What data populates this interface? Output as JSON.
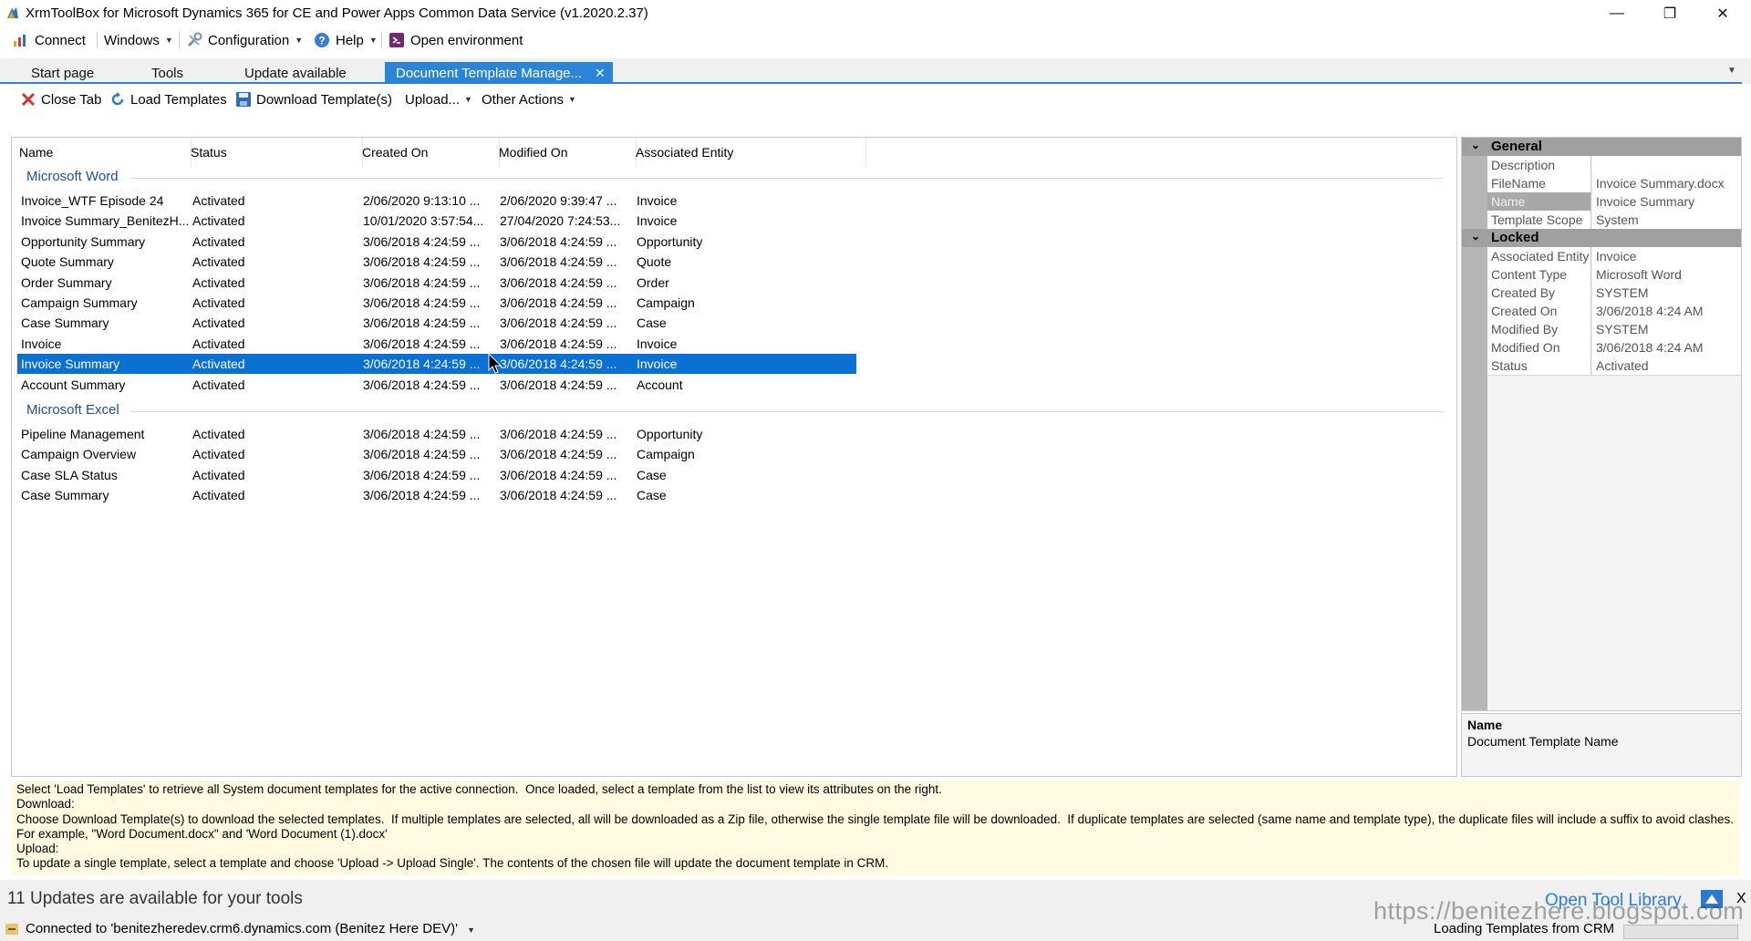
{
  "window": {
    "title": "XrmToolBox for Microsoft Dynamics 365 for CE and Power Apps Common Data Service (v1.2020.2.37)",
    "minimize": "—",
    "maximize": "❐",
    "close": "✕"
  },
  "menu": {
    "connect": "Connect",
    "windows": "Windows",
    "configuration": "Configuration",
    "help": "Help",
    "open_env": "Open environment"
  },
  "tabs": [
    "Start page",
    "Tools",
    "Update available",
    "Document Template Manage..."
  ],
  "toolbar": {
    "close_tab": "Close Tab",
    "load_templates": "Load Templates",
    "download": "Download Template(s)",
    "upload": "Upload...",
    "other": "Other Actions"
  },
  "list": {
    "columns": [
      "Name",
      "Status",
      "Created On",
      "Modified On",
      "Associated Entity"
    ],
    "groups": [
      {
        "label": "Microsoft Word",
        "rows": [
          [
            "Invoice_WTF Episode 24",
            "Activated",
            "2/06/2020 9:13:10 ...",
            "2/06/2020 9:39:47 ...",
            "Invoice"
          ],
          [
            "Invoice Summary_BenitezH...",
            "Activated",
            "10/01/2020 3:57:54...",
            "27/04/2020 7:24:53...",
            "Invoice"
          ],
          [
            "Opportunity Summary",
            "Activated",
            "3/06/2018 4:24:59 ...",
            "3/06/2018 4:24:59 ...",
            "Opportunity"
          ],
          [
            "Quote Summary",
            "Activated",
            "3/06/2018 4:24:59 ...",
            "3/06/2018 4:24:59 ...",
            "Quote"
          ],
          [
            "Order Summary",
            "Activated",
            "3/06/2018 4:24:59 ...",
            "3/06/2018 4:24:59 ...",
            "Order"
          ],
          [
            "Campaign Summary",
            "Activated",
            "3/06/2018 4:24:59 ...",
            "3/06/2018 4:24:59 ...",
            "Campaign"
          ],
          [
            "Case Summary",
            "Activated",
            "3/06/2018 4:24:59 ...",
            "3/06/2018 4:24:59 ...",
            "Case"
          ],
          [
            "Invoice",
            "Activated",
            "3/06/2018 4:24:59 ...",
            "3/06/2018 4:24:59 ...",
            "Invoice"
          ],
          [
            "Invoice Summary",
            "Activated",
            "3/06/2018 4:24:59 ...",
            "3/06/2018 4:24:59 ...",
            "Invoice"
          ],
          [
            "Account Summary",
            "Activated",
            "3/06/2018 4:24:59 ...",
            "3/06/2018 4:24:59 ...",
            "Account"
          ]
        ]
      },
      {
        "label": "Microsoft Excel",
        "rows": [
          [
            "Pipeline Management",
            "Activated",
            "3/06/2018 4:24:59 ...",
            "3/06/2018 4:24:59 ...",
            "Opportunity"
          ],
          [
            "Campaign Overview",
            "Activated",
            "3/06/2018 4:24:59 ...",
            "3/06/2018 4:24:59 ...",
            "Campaign"
          ],
          [
            "Case SLA Status",
            "Activated",
            "3/06/2018 4:24:59 ...",
            "3/06/2018 4:24:59 ...",
            "Case"
          ],
          [
            "Case Summary",
            "Activated",
            "3/06/2018 4:24:59 ...",
            "3/06/2018 4:24:59 ...",
            "Case"
          ]
        ]
      }
    ],
    "selected_group": 0,
    "selected_row": 8
  },
  "properties": {
    "categories": [
      {
        "label": "General",
        "toggle": "⌄",
        "rows": [
          [
            "Description",
            ""
          ],
          [
            "FileName",
            "Invoice Summary.docx"
          ],
          [
            "Name",
            "Invoice Summary"
          ],
          [
            "Template Scope",
            "System"
          ]
        ]
      },
      {
        "label": "Locked",
        "toggle": "⌄",
        "rows": [
          [
            "Associated Entity l",
            "Invoice"
          ],
          [
            "Content Type",
            "Microsoft Word"
          ],
          [
            "Created By",
            "SYSTEM"
          ],
          [
            "Created On",
            "3/06/2018 4:24 AM"
          ],
          [
            "Modified By",
            "SYSTEM"
          ],
          [
            "Modified On",
            "3/06/2018 4:24 AM"
          ],
          [
            "Status",
            "Activated"
          ]
        ]
      }
    ],
    "selected_property": "Name",
    "description_title": "Name",
    "description_text": "Document Template Name"
  },
  "info": [
    "Select 'Load Templates' to retrieve all System document templates for the active connection.  Once loaded, select a template from the list to view its attributes on the right.",
    "Download:",
    "Choose Download Template(s) to download the selected templates.  If multiple templates are selected, all will be downloaded as a Zip file, otherwise the single template file will be downloaded.  If duplicate templates are selected (same name and template type), the duplicate files will include a suffix to avoid clashes. For example, \"Word Document.docx\" and 'Word Document (1).docx'",
    "Upload:",
    "To update a single template, select a template and choose 'Upload -> Upload Single'. The contents of the chosen file will update the document template in CRM."
  ],
  "updates_bar": {
    "message": "11 Updates are available for your tools",
    "link": "Open Tool Library",
    "close": "X"
  },
  "status": {
    "connection": "Connected to 'benitezheredev.crm6.dynamics.com (Benitez Here DEV)'",
    "progress": "Loading Templates from CRM",
    "watermark": "https://benitezhere.blogspot.com"
  },
  "colors": {
    "accent": "#2a85d6",
    "selection": "#0a70d4",
    "group_text": "#1f4e9b",
    "info_bg": "#fffbe0"
  }
}
